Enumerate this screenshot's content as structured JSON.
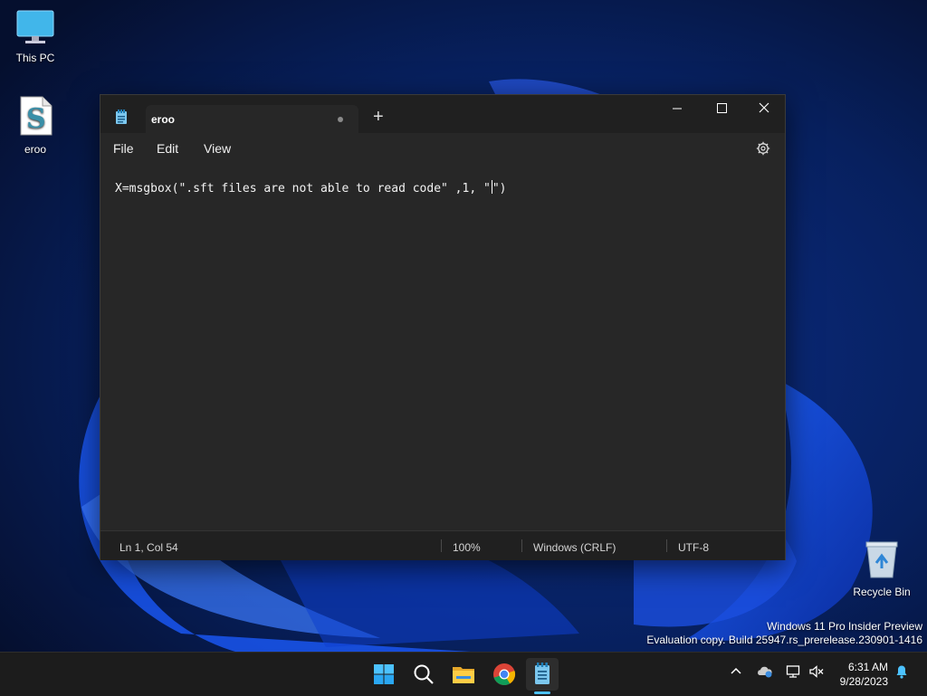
{
  "desktop": {
    "icons": [
      {
        "label": "This PC",
        "icon": "monitor-icon"
      },
      {
        "label": "eroo",
        "icon": "script-file-icon"
      },
      {
        "label": "Recycle Bin",
        "icon": "recycle-bin-icon"
      }
    ],
    "watermark": {
      "line1": "Windows 11 Pro Insider Preview",
      "line2": "Evaluation copy. Build 25947.rs_prerelease.230901-1416"
    }
  },
  "notepad": {
    "tab_title": "eroo",
    "new_tab_symbol": "+",
    "menu": [
      "File",
      "Edit",
      "View"
    ],
    "content_before_caret": "X=msgbox(\".sft files are not able to read code\" ,1, \"",
    "content_after_caret": "\")",
    "status": {
      "position": "Ln 1, Col 54",
      "zoom": "100%",
      "line_ending": "Windows (CRLF)",
      "encoding": "UTF-8"
    }
  },
  "taskbar": {
    "apps": [
      "start-icon",
      "search-icon",
      "file-explorer-icon",
      "chrome-icon",
      "notepad-icon"
    ],
    "clock": {
      "time": "6:31 AM",
      "date": "9/28/2023"
    }
  },
  "colors": {
    "accent": "#4cc2ff",
    "window_bg": "#272727",
    "titlebar_bg": "#202020",
    "taskbar_bg": "#1c1c1c"
  }
}
